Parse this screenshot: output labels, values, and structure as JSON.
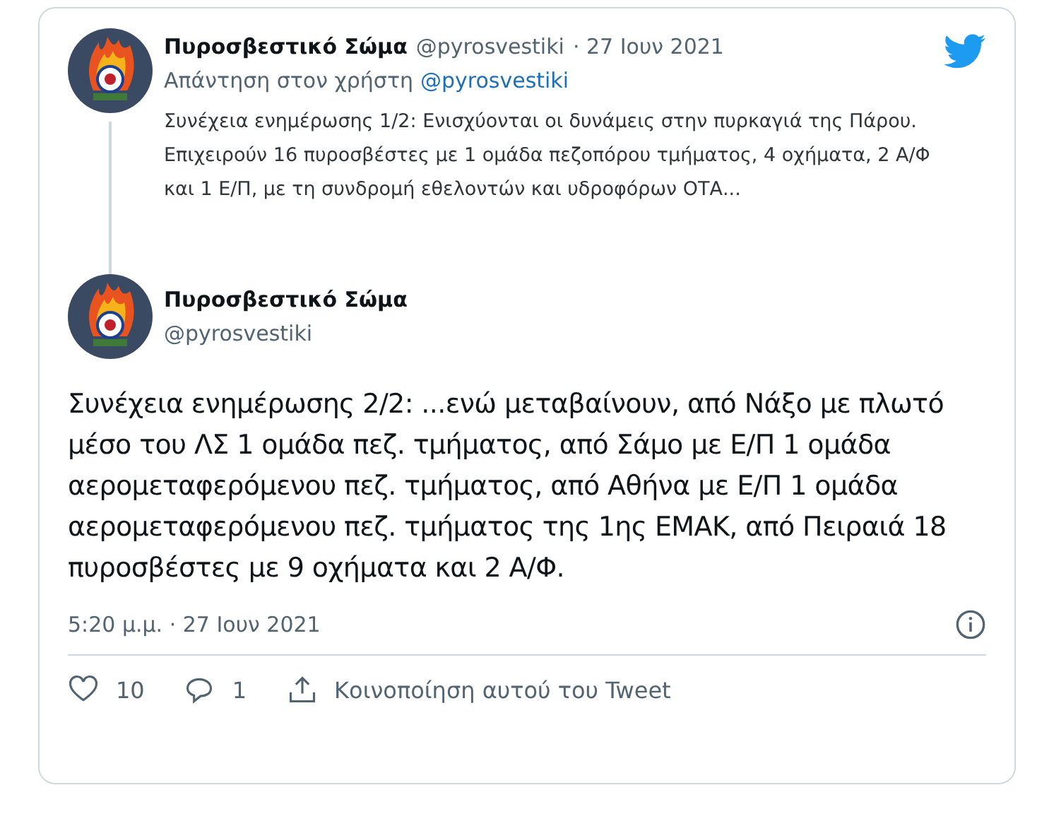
{
  "parent_tweet": {
    "author": "Πυροσβεστικό Σώμα",
    "handle": "@pyrosvestiki",
    "date": "· 27 Ιουν 2021",
    "reply_prefix": "Απάντηση στον χρήστη",
    "reply_to": "@pyrosvestiki",
    "text": "Συνέχεια ενημέρωσης 1/2: Ενισχύονται οι δυνάμεις στην πυρκαγιά της Πάρου. Επιχειρούν 16 πυροσβέστες με 1 ομάδα πεζοπόρου τμήματος, 4 οχήματα, 2 Α/Φ και 1 Ε/Π, με τη συνδρομή εθελοντών και υδροφόρων ΟΤΑ..."
  },
  "tweet": {
    "author": "Πυροσβεστικό Σώμα",
    "handle": "@pyrosvestiki",
    "text": "Συνέχεια ενημέρωσης 2/2: ...ενώ μεταβαίνουν, από Νάξο με πλωτό μέσο του ΛΣ 1 ομάδα πεζ. τμήματος, από Σάμο με Ε/Π 1 ομάδα αερομεταφερόμενου πεζ. τμήματος, από Αθήνα με Ε/Π 1 ομάδα αερομεταφερόμενου πεζ. τμήματος της 1ης ΕΜΑΚ, από Πειραιά 18 πυροσβέστες με 9 οχήματα και 2 Α/Φ.",
    "timestamp": "5:20 μ.μ. · 27 Ιουν 2021"
  },
  "actions": [
    {
      "kind": "like",
      "label": "10"
    },
    {
      "kind": "reply",
      "label": "1"
    },
    {
      "kind": "share",
      "label": "Κοινοποίηση αυτού του Tweet"
    }
  ]
}
